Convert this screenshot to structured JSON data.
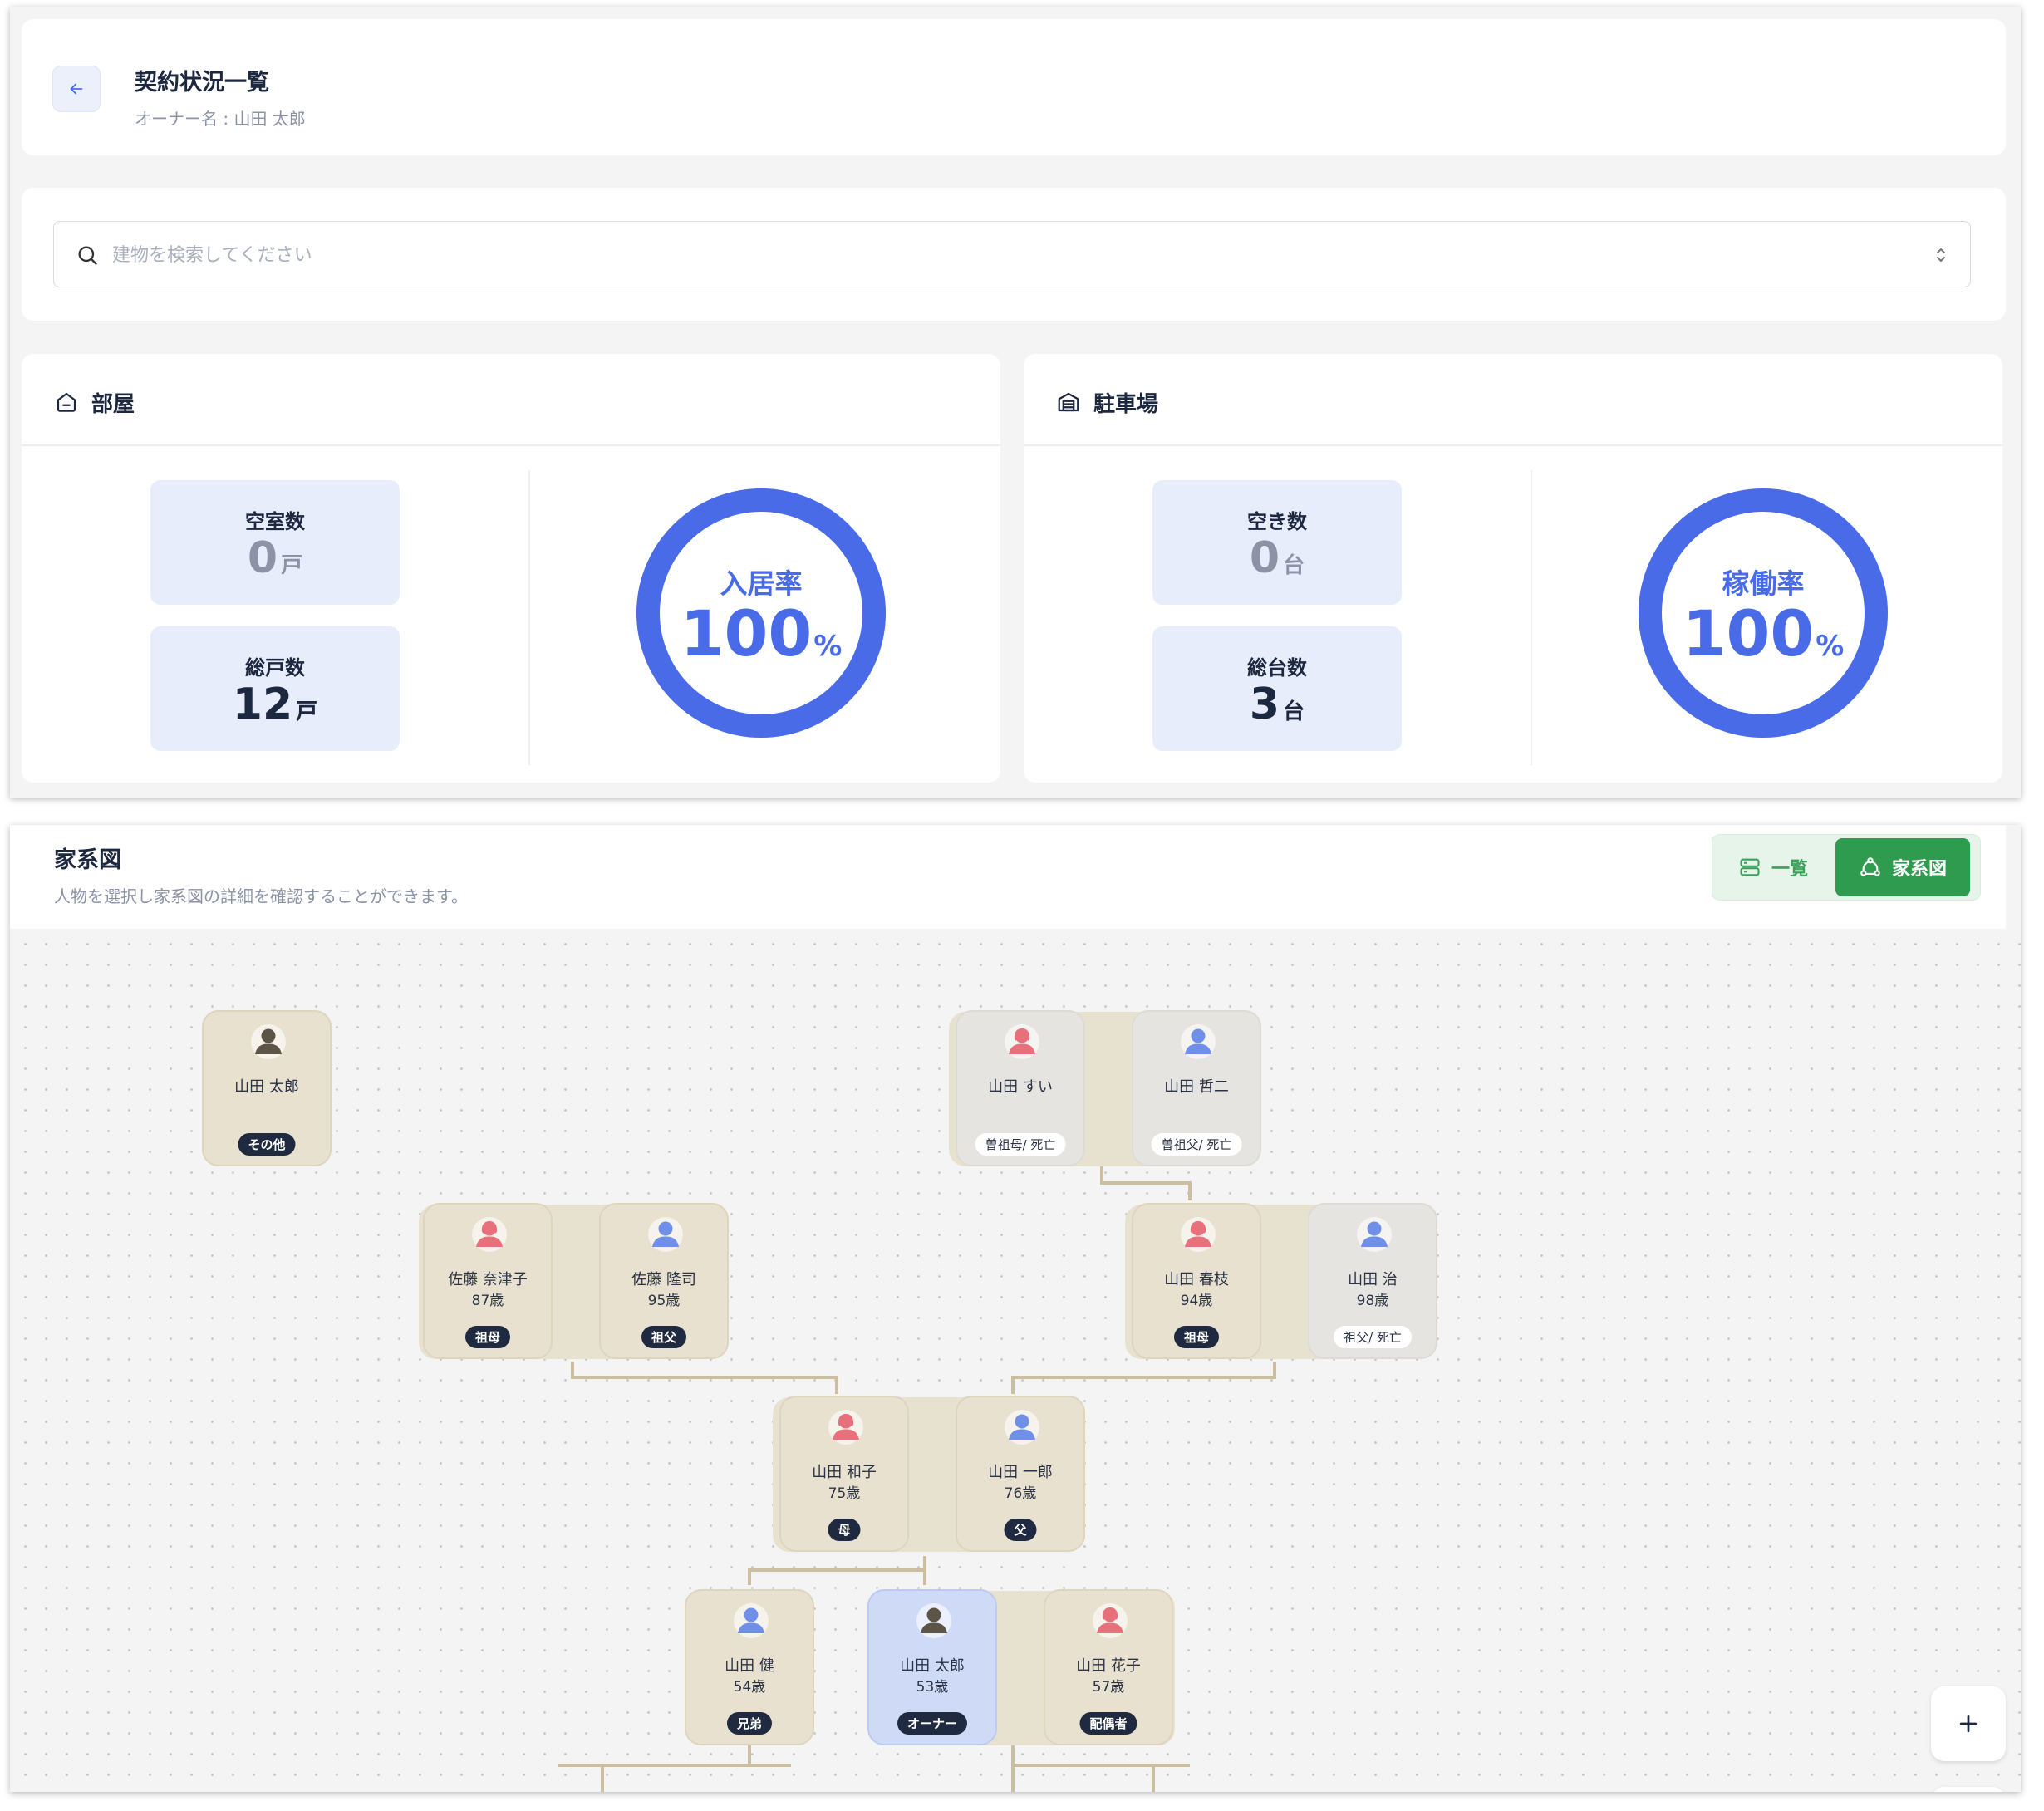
{
  "header": {
    "title": "契約状況一覧",
    "owner_line": "オーナー名 : 山田 太郎"
  },
  "search": {
    "placeholder": "建物を検索してください",
    "value": ""
  },
  "rooms": {
    "title": "部屋",
    "vacant": {
      "label": "空室数",
      "value": "0",
      "unit": "戸"
    },
    "total": {
      "label": "総戸数",
      "value": "12",
      "unit": "戸"
    },
    "rate": {
      "label": "入居率",
      "value": "100",
      "unit": "%",
      "fraction": 1.0
    }
  },
  "parking": {
    "title": "駐車場",
    "vacant": {
      "label": "空き数",
      "value": "0",
      "unit": "台"
    },
    "total": {
      "label": "総台数",
      "value": "3",
      "unit": "台"
    },
    "rate": {
      "label": "稼働率",
      "value": "100",
      "unit": "%",
      "fraction": 1.0
    }
  },
  "family": {
    "title": "家系図",
    "subtitle": "人物を選択し家系図の詳細を確認することができます。",
    "toggle": {
      "list_label": "一覧",
      "tree_label": "家系図",
      "active": "tree"
    },
    "people": [
      {
        "id": "self_other",
        "name": "山田 太郎",
        "age": "",
        "relation": "その他",
        "gender": "owner"
      },
      {
        "id": "ggm",
        "name": "山田 すい",
        "age": "",
        "relation": "曽祖母/ 死亡",
        "gender": "female"
      },
      {
        "id": "ggf",
        "name": "山田 哲二",
        "age": "",
        "relation": "曽祖父/ 死亡",
        "gender": "male"
      },
      {
        "id": "mgm",
        "name": "佐藤 奈津子",
        "age": "87歳",
        "relation": "祖母",
        "gender": "female"
      },
      {
        "id": "mgf",
        "name": "佐藤 隆司",
        "age": "95歳",
        "relation": "祖父",
        "gender": "male"
      },
      {
        "id": "pgm",
        "name": "山田 春枝",
        "age": "94歳",
        "relation": "祖母",
        "gender": "female"
      },
      {
        "id": "pgf",
        "name": "山田 治",
        "age": "98歳",
        "relation": "祖父/ 死亡",
        "gender": "male"
      },
      {
        "id": "mother",
        "name": "山田 和子",
        "age": "75歳",
        "relation": "母",
        "gender": "female"
      },
      {
        "id": "father",
        "name": "山田 一郎",
        "age": "76歳",
        "relation": "父",
        "gender": "male"
      },
      {
        "id": "brother",
        "name": "山田 健",
        "age": "54歳",
        "relation": "兄弟",
        "gender": "male"
      },
      {
        "id": "owner",
        "name": "山田 太郎",
        "age": "53歳",
        "relation": "オーナー",
        "gender": "owner"
      },
      {
        "id": "spouse",
        "name": "山田 花子",
        "age": "57歳",
        "relation": "配偶者",
        "gender": "female"
      }
    ]
  },
  "colors": {
    "accent": "#4a6be8",
    "green": "#2e9b4f",
    "female": "#e8707a",
    "male": "#6f8fe8",
    "owner": "#5b5447"
  },
  "icons": {
    "back": "arrow-left-icon",
    "search": "search-icon",
    "rooms": "home-icon",
    "parking": "garage-icon",
    "list": "list-icon",
    "tree": "tree-icon",
    "zoom_in": "plus-icon",
    "zoom_out": "minus-icon"
  }
}
